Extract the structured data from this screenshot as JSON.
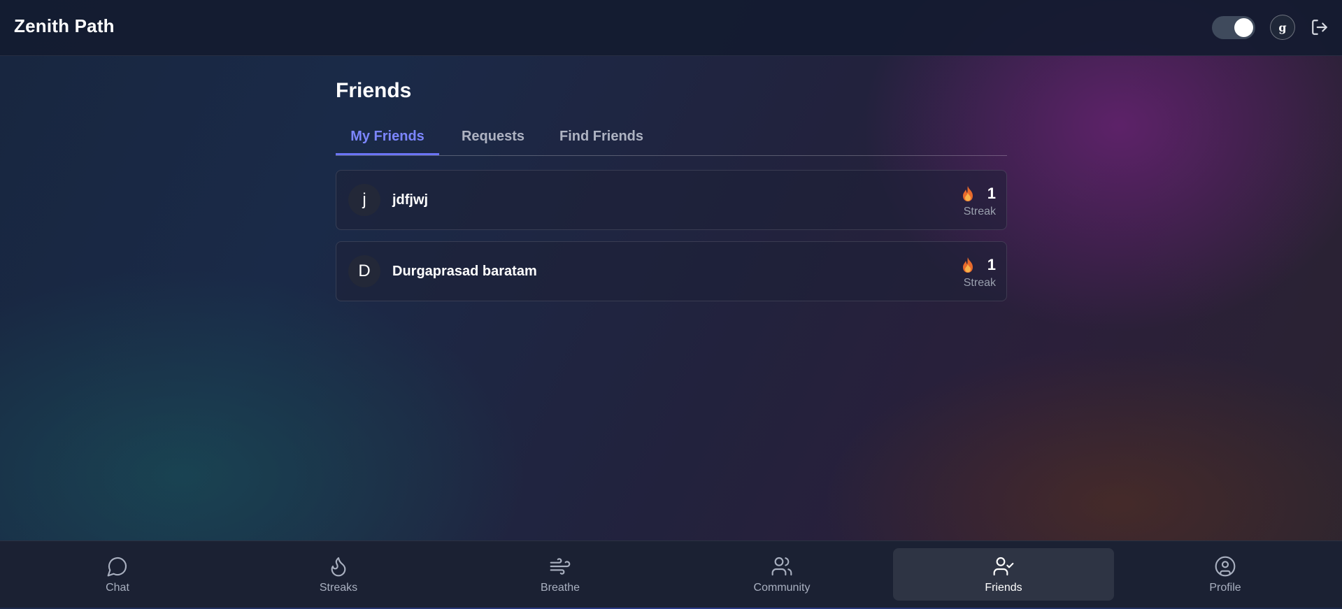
{
  "header": {
    "app_title": "Zenith Path",
    "user_initial": "g",
    "theme_toggle_on": true
  },
  "page": {
    "title": "Friends"
  },
  "tabs": [
    {
      "label": "My Friends",
      "active": true
    },
    {
      "label": "Requests",
      "active": false
    },
    {
      "label": "Find Friends",
      "active": false
    }
  ],
  "friends": [
    {
      "initial": "j",
      "name": "jdfjwj",
      "streak": "1",
      "streak_label": "Streak"
    },
    {
      "initial": "D",
      "name": "Durgaprasad baratam",
      "streak": "1",
      "streak_label": "Streak"
    }
  ],
  "bottom_nav": [
    {
      "label": "Chat",
      "icon": "chat-bubble-icon",
      "active": false
    },
    {
      "label": "Streaks",
      "icon": "flame-icon",
      "active": false
    },
    {
      "label": "Breathe",
      "icon": "wind-icon",
      "active": false
    },
    {
      "label": "Community",
      "icon": "users-icon",
      "active": false
    },
    {
      "label": "Friends",
      "icon": "user-check-icon",
      "active": true
    },
    {
      "label": "Profile",
      "icon": "user-circle-icon",
      "active": false
    }
  ],
  "colors": {
    "accent": "#7c86ff",
    "streak_fire": "#f08a3a"
  }
}
